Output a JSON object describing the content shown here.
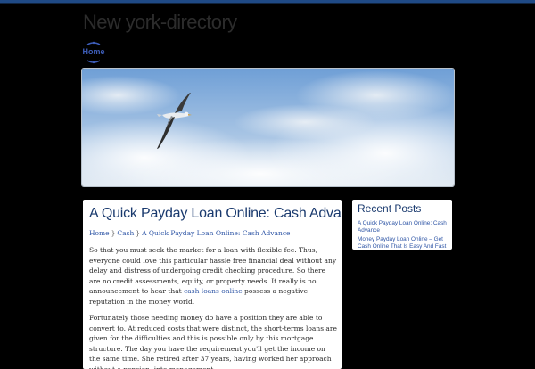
{
  "site": {
    "title": "New york-directory"
  },
  "nav": {
    "home_label": "Home"
  },
  "colors": {
    "accent": "#1f4a86",
    "link": "#2f56a6",
    "title_text": "#1a3a6e",
    "background": "#000000"
  },
  "post": {
    "title": "A Quick Payday Loan Online: Cash Advance",
    "breadcrumb": [
      "Home",
      "Cash",
      "A Quick Payday Loan Online: Cash Advance"
    ],
    "breadcrumb_separator": "}",
    "paragraph1_before_link": "So that you must seek the market for a loan with flexible fee. Thus, everyone could love this particular hassle free financial deal without any delay and distress of undergoing credit checking procedure. So there are no credit assessments, equity, or property needs. It really is no announcement to hear that ",
    "paragraph1_link": "cash loans online",
    "paragraph1_after_link": " possess a negative reputation in the money world.",
    "paragraph2": "Fortunately those needing money do have a position they are able to convert to. At reduced costs that were distinct, the short-terms loans are given for the difficulties and this is possible only by this mortgage structure. The day you have the requirement you'll get the income on the same time. She retired after 37 years, having worked her approach without a pension, into management."
  },
  "sidebar": {
    "recent_title": "Recent Posts",
    "recent_posts": [
      "A Quick Payday Loan Online: Cash Advance",
      "Money Payday Loan Online – Get Cash Online That Is Easy And Fast"
    ]
  },
  "banner": {
    "icon": "seagull-in-cloudy-sky-image"
  }
}
